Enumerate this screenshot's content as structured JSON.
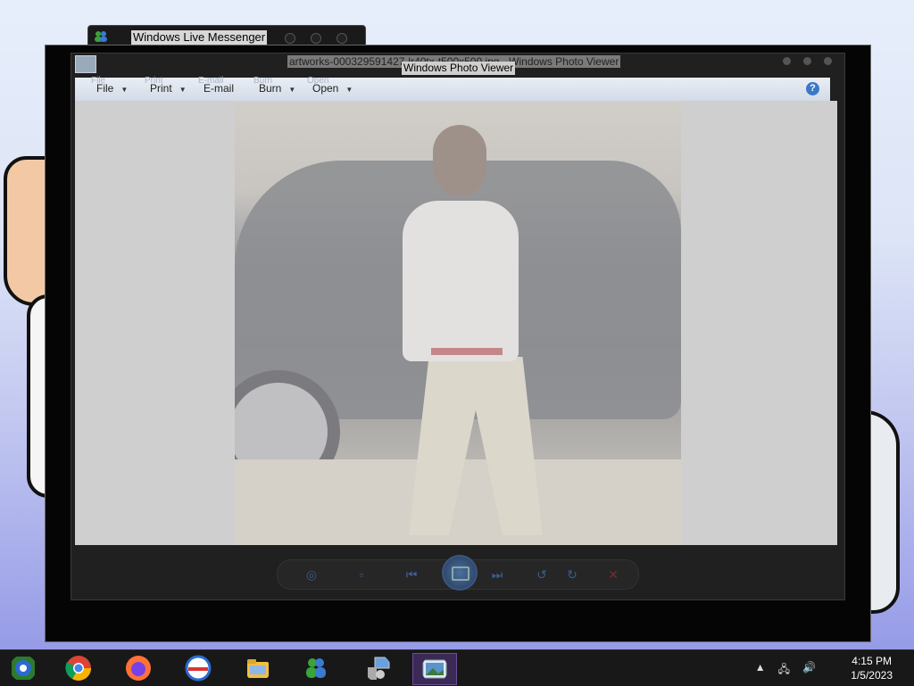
{
  "messenger": {
    "title": "Windows Live Messenger"
  },
  "photo_viewer": {
    "title_file": "artworks-000329591427-lr40tx-t500x500.jpg - Windows Photo Viewer",
    "title_overlay": "Windows Photo Viewer",
    "menu": [
      {
        "label": "File",
        "ghost": "File"
      },
      {
        "label": "Print",
        "ghost": "Print"
      },
      {
        "label": "E-mail",
        "ghost": "E-mail"
      },
      {
        "label": "Burn",
        "ghost": "Burn"
      },
      {
        "label": "Open",
        "ghost": "Open"
      }
    ],
    "help": "?"
  },
  "taskbar": {
    "pinned": [
      {
        "name": "Windows Media Center"
      },
      {
        "name": "Google Chrome"
      },
      {
        "name": "Mozilla Firefox"
      },
      {
        "name": "Internet Explorer"
      },
      {
        "name": "Windows Explorer"
      },
      {
        "name": "Windows Live Messenger"
      },
      {
        "name": "Network Setup"
      },
      {
        "name": "Windows Photo Viewer"
      }
    ],
    "clock": {
      "time": "4:15 PM",
      "date": "1/5/2023"
    }
  },
  "colors": {
    "taskbar": "#181818",
    "active_task": "#3b2a55",
    "help_blue": "#3a78c9"
  }
}
